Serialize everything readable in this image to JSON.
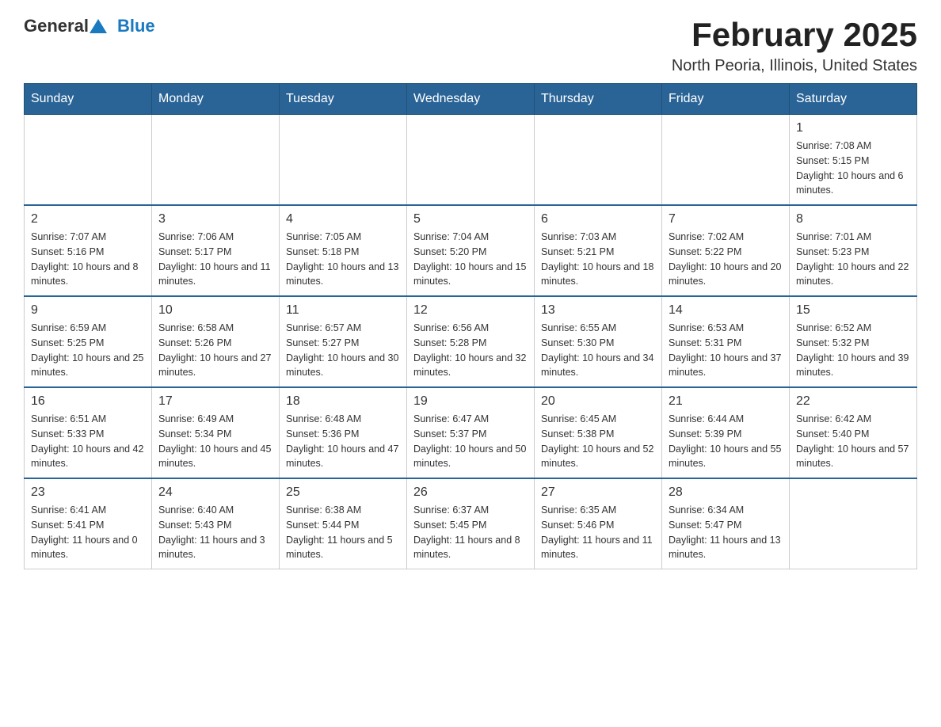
{
  "logo": {
    "text_general": "General",
    "text_blue": "Blue"
  },
  "title": "February 2025",
  "location": "North Peoria, Illinois, United States",
  "days_of_week": [
    "Sunday",
    "Monday",
    "Tuesday",
    "Wednesday",
    "Thursday",
    "Friday",
    "Saturday"
  ],
  "weeks": [
    [
      {
        "day": "",
        "info": ""
      },
      {
        "day": "",
        "info": ""
      },
      {
        "day": "",
        "info": ""
      },
      {
        "day": "",
        "info": ""
      },
      {
        "day": "",
        "info": ""
      },
      {
        "day": "",
        "info": ""
      },
      {
        "day": "1",
        "info": "Sunrise: 7:08 AM\nSunset: 5:15 PM\nDaylight: 10 hours and 6 minutes."
      }
    ],
    [
      {
        "day": "2",
        "info": "Sunrise: 7:07 AM\nSunset: 5:16 PM\nDaylight: 10 hours and 8 minutes."
      },
      {
        "day": "3",
        "info": "Sunrise: 7:06 AM\nSunset: 5:17 PM\nDaylight: 10 hours and 11 minutes."
      },
      {
        "day": "4",
        "info": "Sunrise: 7:05 AM\nSunset: 5:18 PM\nDaylight: 10 hours and 13 minutes."
      },
      {
        "day": "5",
        "info": "Sunrise: 7:04 AM\nSunset: 5:20 PM\nDaylight: 10 hours and 15 minutes."
      },
      {
        "day": "6",
        "info": "Sunrise: 7:03 AM\nSunset: 5:21 PM\nDaylight: 10 hours and 18 minutes."
      },
      {
        "day": "7",
        "info": "Sunrise: 7:02 AM\nSunset: 5:22 PM\nDaylight: 10 hours and 20 minutes."
      },
      {
        "day": "8",
        "info": "Sunrise: 7:01 AM\nSunset: 5:23 PM\nDaylight: 10 hours and 22 minutes."
      }
    ],
    [
      {
        "day": "9",
        "info": "Sunrise: 6:59 AM\nSunset: 5:25 PM\nDaylight: 10 hours and 25 minutes."
      },
      {
        "day": "10",
        "info": "Sunrise: 6:58 AM\nSunset: 5:26 PM\nDaylight: 10 hours and 27 minutes."
      },
      {
        "day": "11",
        "info": "Sunrise: 6:57 AM\nSunset: 5:27 PM\nDaylight: 10 hours and 30 minutes."
      },
      {
        "day": "12",
        "info": "Sunrise: 6:56 AM\nSunset: 5:28 PM\nDaylight: 10 hours and 32 minutes."
      },
      {
        "day": "13",
        "info": "Sunrise: 6:55 AM\nSunset: 5:30 PM\nDaylight: 10 hours and 34 minutes."
      },
      {
        "day": "14",
        "info": "Sunrise: 6:53 AM\nSunset: 5:31 PM\nDaylight: 10 hours and 37 minutes."
      },
      {
        "day": "15",
        "info": "Sunrise: 6:52 AM\nSunset: 5:32 PM\nDaylight: 10 hours and 39 minutes."
      }
    ],
    [
      {
        "day": "16",
        "info": "Sunrise: 6:51 AM\nSunset: 5:33 PM\nDaylight: 10 hours and 42 minutes."
      },
      {
        "day": "17",
        "info": "Sunrise: 6:49 AM\nSunset: 5:34 PM\nDaylight: 10 hours and 45 minutes."
      },
      {
        "day": "18",
        "info": "Sunrise: 6:48 AM\nSunset: 5:36 PM\nDaylight: 10 hours and 47 minutes."
      },
      {
        "day": "19",
        "info": "Sunrise: 6:47 AM\nSunset: 5:37 PM\nDaylight: 10 hours and 50 minutes."
      },
      {
        "day": "20",
        "info": "Sunrise: 6:45 AM\nSunset: 5:38 PM\nDaylight: 10 hours and 52 minutes."
      },
      {
        "day": "21",
        "info": "Sunrise: 6:44 AM\nSunset: 5:39 PM\nDaylight: 10 hours and 55 minutes."
      },
      {
        "day": "22",
        "info": "Sunrise: 6:42 AM\nSunset: 5:40 PM\nDaylight: 10 hours and 57 minutes."
      }
    ],
    [
      {
        "day": "23",
        "info": "Sunrise: 6:41 AM\nSunset: 5:41 PM\nDaylight: 11 hours and 0 minutes."
      },
      {
        "day": "24",
        "info": "Sunrise: 6:40 AM\nSunset: 5:43 PM\nDaylight: 11 hours and 3 minutes."
      },
      {
        "day": "25",
        "info": "Sunrise: 6:38 AM\nSunset: 5:44 PM\nDaylight: 11 hours and 5 minutes."
      },
      {
        "day": "26",
        "info": "Sunrise: 6:37 AM\nSunset: 5:45 PM\nDaylight: 11 hours and 8 minutes."
      },
      {
        "day": "27",
        "info": "Sunrise: 6:35 AM\nSunset: 5:46 PM\nDaylight: 11 hours and 11 minutes."
      },
      {
        "day": "28",
        "info": "Sunrise: 6:34 AM\nSunset: 5:47 PM\nDaylight: 11 hours and 13 minutes."
      },
      {
        "day": "",
        "info": ""
      }
    ]
  ]
}
